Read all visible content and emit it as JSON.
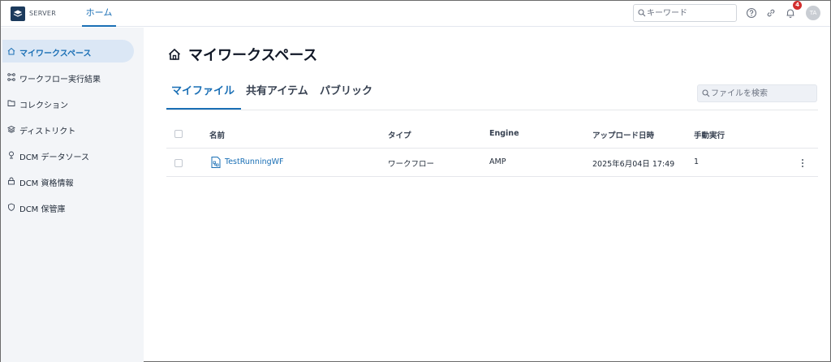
{
  "header": {
    "logo_text": "SERVER",
    "nav_home": "ホーム",
    "search_placeholder": "キーワード",
    "notification_count": "4",
    "avatar_initials": "TA"
  },
  "sidebar": {
    "items": [
      {
        "label": "マイワークスペース",
        "icon": "home-icon"
      },
      {
        "label": "ワークフロー実行結果",
        "icon": "workflow-results-icon"
      },
      {
        "label": "コレクション",
        "icon": "folder-icon"
      },
      {
        "label": "ディストリクト",
        "icon": "layers-icon"
      },
      {
        "label": "DCM データソース",
        "icon": "datasource-icon"
      },
      {
        "label": "DCM 資格情報",
        "icon": "lock-icon"
      },
      {
        "label": "DCM 保管庫",
        "icon": "shield-icon"
      }
    ]
  },
  "main": {
    "title": "マイワークスペース",
    "tabs": [
      {
        "label": "マイファイル",
        "active": true
      },
      {
        "label": "共有アイテム",
        "active": false
      },
      {
        "label": "パブリック",
        "active": false
      }
    ],
    "file_search_placeholder": "ファイルを検索",
    "table": {
      "headers": {
        "name": "名前",
        "type": "タイプ",
        "engine": "Engine",
        "upload_date": "アップロード日時",
        "manual_runs": "手動実行"
      },
      "rows": [
        {
          "name": "TestRunningWF",
          "type": "ワークフロー",
          "engine": "AMP",
          "upload_date": "2025年6月04日 17:49",
          "manual_runs": "1"
        }
      ]
    }
  },
  "colors": {
    "accent": "#1a6fb5",
    "sidebar_bg": "#f3f5f8",
    "sidebar_active_bg": "#dbe7f5",
    "badge": "#d32f2f"
  }
}
